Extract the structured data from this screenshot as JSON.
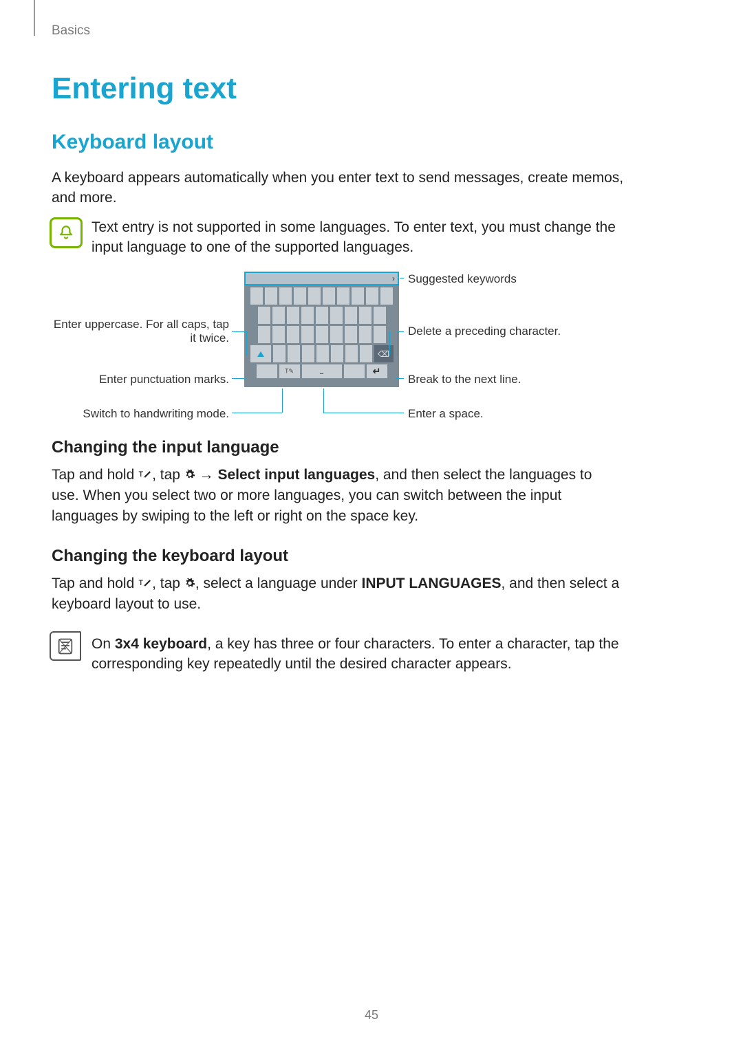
{
  "breadcrumb": "Basics",
  "title": "Entering text",
  "section1_heading": "Keyboard layout",
  "section1_p1": "A keyboard appears automatically when you enter text to send messages, create memos, and more.",
  "bell_note": "Text entry is not supported in some languages. To enter text, you must change the input language to one of the supported languages.",
  "diagram": {
    "right": {
      "suggested": "Suggested keywords",
      "delete": "Delete a preceding character.",
      "break": "Break to the next line.",
      "space": "Enter a space."
    },
    "left": {
      "uppercase": "Enter uppercase. For all caps, tap it twice.",
      "punctuation": "Enter punctuation marks.",
      "handwriting": "Switch to handwriting mode."
    }
  },
  "section2_heading": "Changing the input language",
  "section2_p_parts": {
    "a": "Tap and hold ",
    "b": ", tap ",
    "arrow": " → ",
    "c_bold": "Select input languages",
    "d": ", and then select the languages to use. When you select two or more languages, you can switch between the input languages by swiping to the left or right on the space key."
  },
  "section3_heading": "Changing the keyboard layout",
  "section3_p_parts": {
    "a": "Tap and hold ",
    "b": ", tap ",
    "c": ", select a language under ",
    "d_bold": "INPUT LANGUAGES",
    "e": ", and then select a keyboard layout to use."
  },
  "memo_note_parts": {
    "a": "On ",
    "b_bold": "3x4 keyboard",
    "c": ", a key has three or four characters. To enter a character, tap the corresponding key repeatedly until the desired character appears."
  },
  "page_number": "45"
}
